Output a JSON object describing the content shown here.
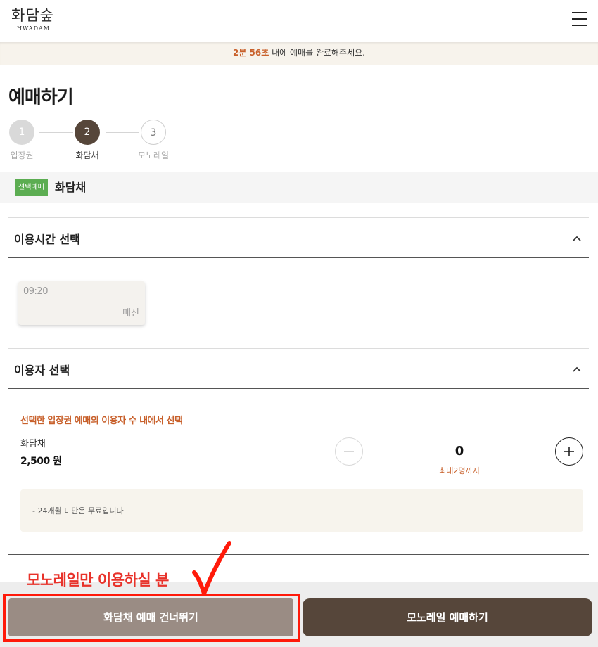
{
  "header": {
    "logo_main": "화담숲",
    "logo_sub": "HWADAM"
  },
  "timer": {
    "time": "2분 56초",
    "message": " 내에 예매를 완료해주세요."
  },
  "page": {
    "title": "예매하기"
  },
  "steps": [
    {
      "number": "1",
      "label": "입장권",
      "state": "done"
    },
    {
      "number": "2",
      "label": "화담채",
      "state": "active"
    },
    {
      "number": "3",
      "label": "모노레일",
      "state": "todo"
    }
  ],
  "selection": {
    "badge": "선택예매",
    "name": "화담채"
  },
  "time_section": {
    "title": "이용시간 선택",
    "slots": [
      {
        "time": "09:20",
        "status": "매진"
      }
    ]
  },
  "user_section": {
    "title": "이용자 선택",
    "notice": "선택한 입장권 예매의 이용자 수 내에서 선택",
    "ticket_name": "화담채",
    "ticket_price": "2,500 원",
    "quantity": "0",
    "max_note": "최대2명까지",
    "info_item": "-   24개월 미만은 무료입니다"
  },
  "annotation": {
    "text": "모노레일만 이용하실 분"
  },
  "buttons": {
    "skip": "화담채 예매 건너뛰기",
    "monorail": "모노레일 예매하기"
  },
  "colors": {
    "accent_orange": "#c8602b",
    "brand_brown": "#56463a",
    "badge_green": "#5cad52",
    "annotation_red": "#e8322a"
  }
}
